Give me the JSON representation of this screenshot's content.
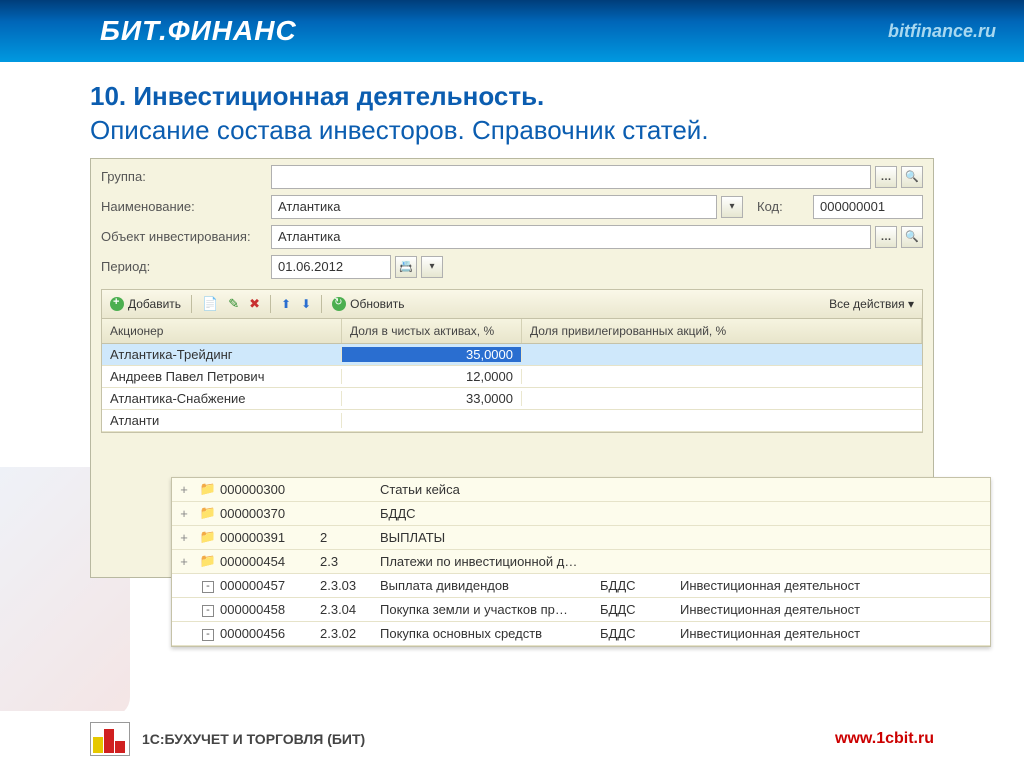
{
  "header": {
    "title": "БИТ.ФИНАНС",
    "url": "bitfinance.ru"
  },
  "slide": {
    "title_bold": "10. Инвестиционная деятельность.",
    "title_rest": "Описание состава инвесторов. Справочник статей."
  },
  "form": {
    "group_label": "Группа:",
    "name_label": "Наименование:",
    "name_value": "Атлантика",
    "code_label": "Код:",
    "code_value": "000000001",
    "object_label": "Объект инвестирования:",
    "object_value": "Атлантика",
    "period_label": "Период:",
    "period_value": "01.06.2012"
  },
  "toolbar": {
    "add": "Добавить",
    "refresh": "Обновить",
    "all_actions": "Все действия ▾"
  },
  "grid": {
    "headers": {
      "c1": "Акционер",
      "c2": "Доля в чистых активах, %",
      "c3": "Доля привилегированных акций, %"
    },
    "rows": [
      {
        "name": "Атлантика-Трейдинг",
        "share": "35,0000",
        "selected": true
      },
      {
        "name": "Андреев Павел Петрович",
        "share": "12,0000"
      },
      {
        "name": "Атлантика-Снабжение",
        "share": "33,0000"
      }
    ],
    "partial_row": "Атланти"
  },
  "tree": [
    {
      "exp": "+",
      "folder": true,
      "code": "000000300",
      "num": "",
      "name": "Статьи кейса",
      "type": "",
      "cat": ""
    },
    {
      "exp": "+",
      "folder": true,
      "code": "000000370",
      "num": "",
      "name": "БДДС",
      "type": "",
      "cat": ""
    },
    {
      "exp": "+",
      "folder": true,
      "code": "000000391",
      "num": "2",
      "name": "ВЫПЛАТЫ",
      "type": "",
      "cat": ""
    },
    {
      "exp": "+",
      "folder": true,
      "code": "000000454",
      "num": "2.3",
      "name": "Платежи по инвестиционной д…",
      "type": "",
      "cat": ""
    },
    {
      "exp": "",
      "folder": false,
      "code": "000000457",
      "num": "2.3.03",
      "name": "Выплата дивидендов",
      "type": "БДДС",
      "cat": "Инвестиционная деятельност"
    },
    {
      "exp": "",
      "folder": false,
      "code": "000000458",
      "num": "2.3.04",
      "name": "Покупка земли и участков пр…",
      "type": "БДДС",
      "cat": "Инвестиционная деятельност"
    },
    {
      "exp": "",
      "folder": false,
      "code": "000000456",
      "num": "2.3.02",
      "name": "Покупка основных средств",
      "type": "БДДС",
      "cat": "Инвестиционная деятельност"
    }
  ],
  "footer": {
    "company": "1С:БУХУЧЕТ И ТОРГОВЛЯ (БИТ)",
    "url": "www.1cbit.ru"
  }
}
